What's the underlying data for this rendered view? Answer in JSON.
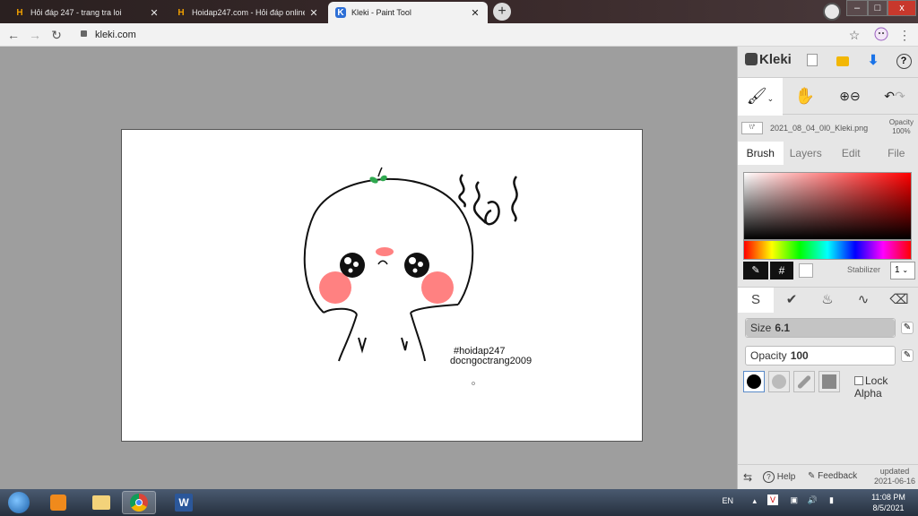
{
  "browser": {
    "tabs": [
      {
        "title": "Hỏi đáp 247 - trang tra loi",
        "favicon": "H",
        "active": false
      },
      {
        "title": "Hoidap247.com - Hỏi đáp online",
        "favicon": "H",
        "active": false
      },
      {
        "title": "Kleki - Paint Tool",
        "favicon": "K",
        "active": true
      }
    ],
    "new_tab": "+",
    "url": "kleki.com",
    "window_buttons": {
      "minimize": "–",
      "maximize": "□",
      "close": "x"
    }
  },
  "canvas": {
    "drawing": "hand-drawn round cartoon character with leaf sprout and squiggle marks",
    "texts": [
      "#hoidap247",
      "docngoctrang2009"
    ]
  },
  "panel": {
    "logo": "Kleki",
    "top_icons": [
      "new-icon",
      "open-icon",
      "download-icon",
      "help-icon"
    ],
    "help_label": "?",
    "tools": [
      "brush",
      "hand",
      "zoom",
      "undo-redo"
    ],
    "file": {
      "name": "2021_08_04_0l0_Kleki.png",
      "opacity_label": "Opacity",
      "opacity_value": "100%",
      "thumb": "\\'/'"
    },
    "tabs": [
      "Brush",
      "Layers",
      "Edit",
      "File"
    ],
    "active_tab": "Brush",
    "color_hex_button": "#",
    "stabilizer_label": "Stabilizer",
    "stabilizer_value": "1",
    "size_label": "Size",
    "size_value": "6.1",
    "opacity_label": "Opacity",
    "opacity_value": "100",
    "lock_alpha": "Lock Alpha",
    "footer": {
      "help": "Help",
      "feedback": "Feedback",
      "updated_label": "updated",
      "updated_date": "2021-06-16"
    }
  },
  "taskbar": {
    "language": "EN",
    "time": "11:08 PM",
    "date": "8/5/2021"
  },
  "colors": {
    "accent_blue": "#1a73e8",
    "workspace_bg": "#9e9e9e",
    "blush": "#ff6b6b",
    "leaf": "#2fa84f"
  }
}
